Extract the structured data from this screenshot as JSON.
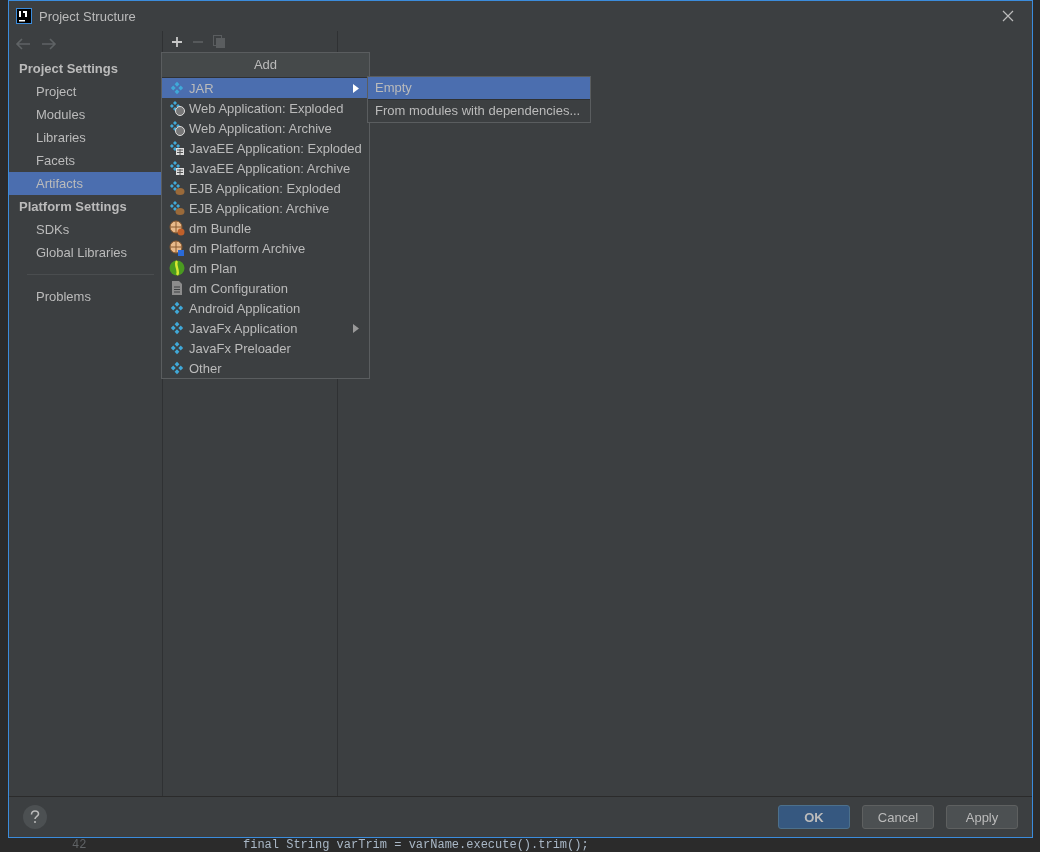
{
  "window": {
    "title": "Project Structure"
  },
  "sidebar": {
    "items": [
      {
        "kind": "header",
        "label": "Project Settings"
      },
      {
        "kind": "item",
        "label": "Project",
        "selected": false
      },
      {
        "kind": "item",
        "label": "Modules",
        "selected": false
      },
      {
        "kind": "item",
        "label": "Libraries",
        "selected": false
      },
      {
        "kind": "item",
        "label": "Facets",
        "selected": false
      },
      {
        "kind": "item",
        "label": "Artifacts",
        "selected": true
      },
      {
        "kind": "header",
        "label": "Platform Settings"
      },
      {
        "kind": "item",
        "label": "SDKs",
        "selected": false
      },
      {
        "kind": "item",
        "label": "Global Libraries",
        "selected": false
      },
      {
        "kind": "separator"
      },
      {
        "kind": "item",
        "label": "Problems",
        "selected": false
      }
    ]
  },
  "add_menu": {
    "title": "Add",
    "items": [
      {
        "label": "JAR",
        "kind": "diamond",
        "submenu": true,
        "selected": true
      },
      {
        "label": "Web Application: Exploded",
        "kind": "web",
        "submenu": false,
        "selected": false
      },
      {
        "label": "Web Application: Archive",
        "kind": "web",
        "submenu": false,
        "selected": false
      },
      {
        "label": "JavaEE Application: Exploded",
        "kind": "javaee",
        "submenu": false,
        "selected": false
      },
      {
        "label": "JavaEE Application: Archive",
        "kind": "javaee",
        "submenu": false,
        "selected": false
      },
      {
        "label": "EJB Application: Exploded",
        "kind": "ejb",
        "submenu": false,
        "selected": false
      },
      {
        "label": "EJB Application: Archive",
        "kind": "ejb",
        "submenu": false,
        "selected": false
      },
      {
        "label": "dm Bundle",
        "kind": "bundle",
        "submenu": false,
        "selected": false
      },
      {
        "label": "dm Platform Archive",
        "kind": "platform",
        "submenu": false,
        "selected": false
      },
      {
        "label": "dm Plan",
        "kind": "plan",
        "submenu": false,
        "selected": false
      },
      {
        "label": "dm Configuration",
        "kind": "config",
        "submenu": false,
        "selected": false
      },
      {
        "label": "Android Application",
        "kind": "diamond",
        "submenu": false,
        "selected": false
      },
      {
        "label": "JavaFx Application",
        "kind": "diamond",
        "submenu": true,
        "selected": false
      },
      {
        "label": "JavaFx Preloader",
        "kind": "diamond",
        "submenu": false,
        "selected": false
      },
      {
        "label": "Other",
        "kind": "diamond",
        "submenu": false,
        "selected": false
      }
    ]
  },
  "submenu": {
    "items": [
      {
        "label": "Empty",
        "selected": true
      },
      {
        "label": "From modules with dependencies...",
        "selected": false
      }
    ]
  },
  "buttons": [
    {
      "label": "OK",
      "default": true
    },
    {
      "label": "Cancel",
      "default": false
    },
    {
      "label": "Apply",
      "default": false
    }
  ],
  "editor_behind": {
    "line_number": "42",
    "code": "final String varTrim = varName.execute().trim();"
  }
}
